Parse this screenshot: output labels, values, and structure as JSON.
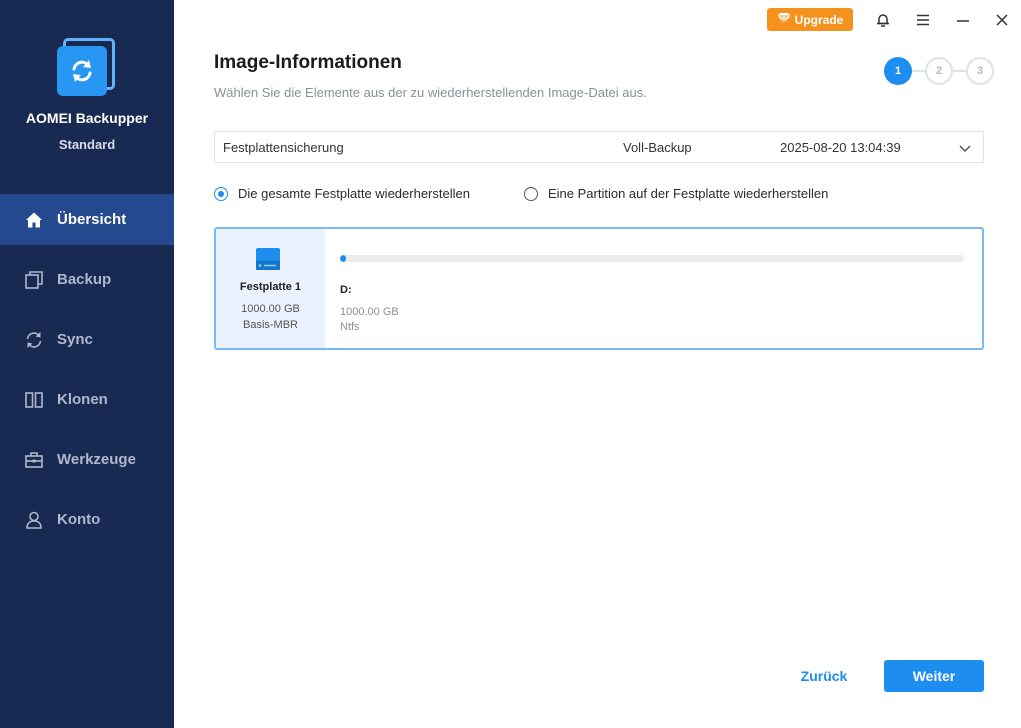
{
  "app": {
    "name": "AOMEI Backupper",
    "edition": "Standard"
  },
  "sidebar": {
    "items": [
      {
        "label": "Übersicht",
        "icon": "home-icon",
        "active": true
      },
      {
        "label": "Backup",
        "icon": "backup-icon",
        "active": false
      },
      {
        "label": "Sync",
        "icon": "sync-icon",
        "active": false
      },
      {
        "label": "Klonen",
        "icon": "clone-icon",
        "active": false
      },
      {
        "label": "Werkzeuge",
        "icon": "toolbox-icon",
        "active": false
      },
      {
        "label": "Konto",
        "icon": "user-icon",
        "active": false
      }
    ]
  },
  "topbar": {
    "upgrade_label": "Upgrade",
    "icons": [
      "bell-icon",
      "menu-icon",
      "minimize-icon",
      "close-icon"
    ]
  },
  "main": {
    "title": "Image-Informationen",
    "subtitle": "Wählen Sie die Elemente aus der zu wiederherstellenden Image-Datei aus.",
    "steps": [
      "1",
      "2",
      "3"
    ],
    "current_step": 1,
    "backup": {
      "name": "Festplattensicherung",
      "type": "Voll-Backup",
      "date": "2025-08-20 13:04:39"
    },
    "options": [
      {
        "label": "Die gesamte Festplatte wiederherstellen",
        "checked": true
      },
      {
        "label": "Eine Partition auf der Festplatte wiederherstellen",
        "checked": false
      }
    ],
    "disk": {
      "name": "Festplatte 1",
      "size": "1000.00 GB",
      "style": "Basis-MBR",
      "partition": {
        "letter": "D:",
        "size": "1000.00 GB",
        "filesystem": "Ntfs",
        "used_fraction": 0.01
      }
    }
  },
  "footer": {
    "back_label": "Zurück",
    "next_label": "Weiter"
  },
  "colors": {
    "sidebar_bg": "#192a52",
    "sidebar_active": "#25498e",
    "accent": "#1d8ef0",
    "upgrade": "#f5921e"
  }
}
